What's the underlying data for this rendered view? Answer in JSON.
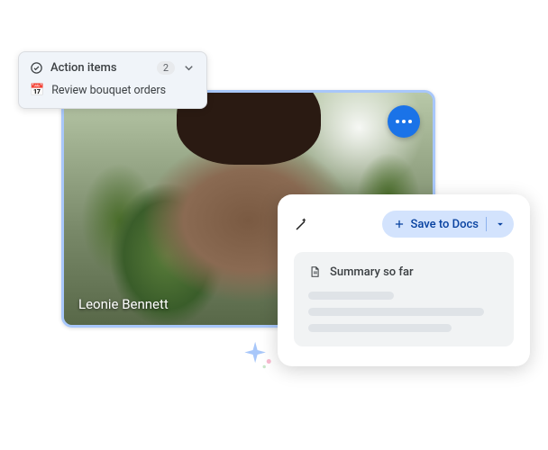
{
  "action_items": {
    "title": "Action items",
    "count": "2",
    "items": [
      {
        "icon": "📅",
        "text": "Review bouquet orders"
      }
    ]
  },
  "video": {
    "participant_name": "Leonie Bennett"
  },
  "summary_panel": {
    "save_button_label": "Save to Docs",
    "section_title": "Summary so far"
  },
  "colors": {
    "accent_blue": "#1a73e8",
    "chip_blue": "#d3e3fd",
    "chip_text": "#0b57d0"
  }
}
